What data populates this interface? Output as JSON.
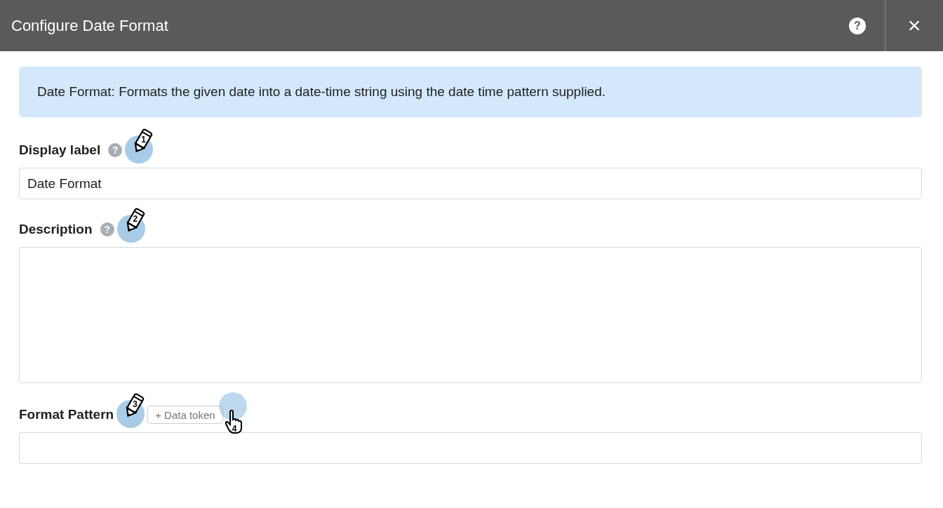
{
  "dialog": {
    "title": "Configure Date Format",
    "help_button": "?",
    "close_button": "×"
  },
  "info": "Date Format: Formats the given date into a date-time string using the date time pattern supplied.",
  "fields": [
    {
      "kind": "input",
      "label": "Display label",
      "help": "?",
      "value": "Date Format",
      "annotation": {
        "kind": "pencil",
        "step": "1"
      }
    },
    {
      "kind": "textarea",
      "label": "Description",
      "help": "?",
      "annotation": {
        "kind": "pencil",
        "step": "2"
      }
    },
    {
      "kind": "input",
      "label": "Format Pattern",
      "annotation": {
        "kind": "pencil",
        "step": "3"
      },
      "token_button": {
        "label": "+ Data token",
        "annotation": {
          "kind": "hand",
          "step": "4"
        }
      }
    }
  ]
}
